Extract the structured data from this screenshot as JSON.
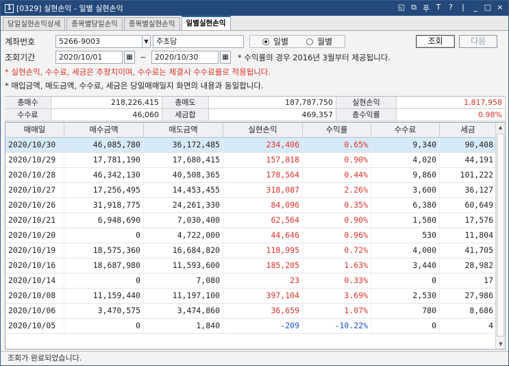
{
  "window": {
    "number": "1",
    "title": "[0329] 실현손익 - 일별 실현손익",
    "controls": [
      "◱",
      "⧉",
      "푸",
      "T",
      "?",
      "|",
      "_",
      "□",
      "×"
    ]
  },
  "tabs": [
    "당일실현손익상세",
    "종목별당일손익",
    "종목별실현손익",
    "일별실현손익"
  ],
  "form": {
    "account_label": "계좌번호",
    "account_value": "5266-9003",
    "account_name": "주초담",
    "radio_daily": "일별",
    "radio_monthly": "월별",
    "query_button": "조회",
    "next_button": "다음",
    "period_label": "조회기간",
    "date_from": "2020/10/01",
    "date_tilde": "~",
    "date_to": "2020/10/30",
    "notice": "* 수익률의 경우 2016년 3월부터 제공됩니다.",
    "note_red": "* 실현손익, 수수료, 세금은 추정치이며, 수수료는 체결시 수수료률로 적용됩니다.",
    "note_black": "* 매입금액, 매도금액, 수수료, 세금은 당일매매일지 화면의 내용과 동일합니다."
  },
  "summary": {
    "buy_total_label": "총매수",
    "buy_total": "218,226,415",
    "sell_total_label": "총매도",
    "sell_total": "187,787,750",
    "realized_label": "실현손익",
    "realized": "1,817,958",
    "fee_label": "수수료",
    "fee": "46,060",
    "tax_label": "세금합",
    "tax": "469,357",
    "return_label": "총수익률",
    "return": "0.98%"
  },
  "table": {
    "columns": [
      "매매일",
      "매수금액",
      "매도금액",
      "실현손익",
      "수익률",
      "수수료",
      "세금"
    ],
    "rows": [
      [
        "2020/10/30",
        "46,085,780",
        "36,172,485",
        "234,406",
        "0.65%",
        "9,340",
        "90,408"
      ],
      [
        "2020/10/29",
        "17,781,190",
        "17,680,415",
        "157,818",
        "0.90%",
        "4,020",
        "44,191"
      ],
      [
        "2020/10/28",
        "46,342,130",
        "40,508,365",
        "178,564",
        "0.44%",
        "9,860",
        "101,222"
      ],
      [
        "2020/10/27",
        "17,256,495",
        "14,453,455",
        "318,087",
        "2.26%",
        "3,600",
        "36,127"
      ],
      [
        "2020/10/26",
        "31,918,775",
        "24,261,330",
        "84,096",
        "0.35%",
        "6,380",
        "60,649"
      ],
      [
        "2020/10/21",
        "6,948,690",
        "7,030,400",
        "62,564",
        "0.90%",
        "1,580",
        "17,576"
      ],
      [
        "2020/10/20",
        "0",
        "4,722,000",
        "44,646",
        "0.96%",
        "530",
        "11,804"
      ],
      [
        "2020/10/19",
        "18,575,360",
        "16,684,820",
        "118,995",
        "0.72%",
        "4,000",
        "41,705"
      ],
      [
        "2020/10/16",
        "18,687,980",
        "11,593,600",
        "185,205",
        "1.63%",
        "3,440",
        "28,982"
      ],
      [
        "2020/10/14",
        "0",
        "7,080",
        "23",
        "0.33%",
        "0",
        "17"
      ],
      [
        "2020/10/08",
        "11,159,440",
        "11,197,100",
        "397,104",
        "3.69%",
        "2,530",
        "27,986"
      ],
      [
        "2020/10/06",
        "3,470,575",
        "3,474,860",
        "36,659",
        "1.07%",
        "780",
        "8,686"
      ],
      [
        "2020/10/05",
        "0",
        "1,840",
        "-209",
        "-10.22%",
        "0",
        "4"
      ]
    ],
    "selected_row": 0
  },
  "status": "조회가 완료되었습니다.",
  "colors": {
    "titlebar": "#23497a",
    "positive": "#e0312a",
    "negative": "#1c4fd0",
    "selected": "#d6e9f7"
  }
}
